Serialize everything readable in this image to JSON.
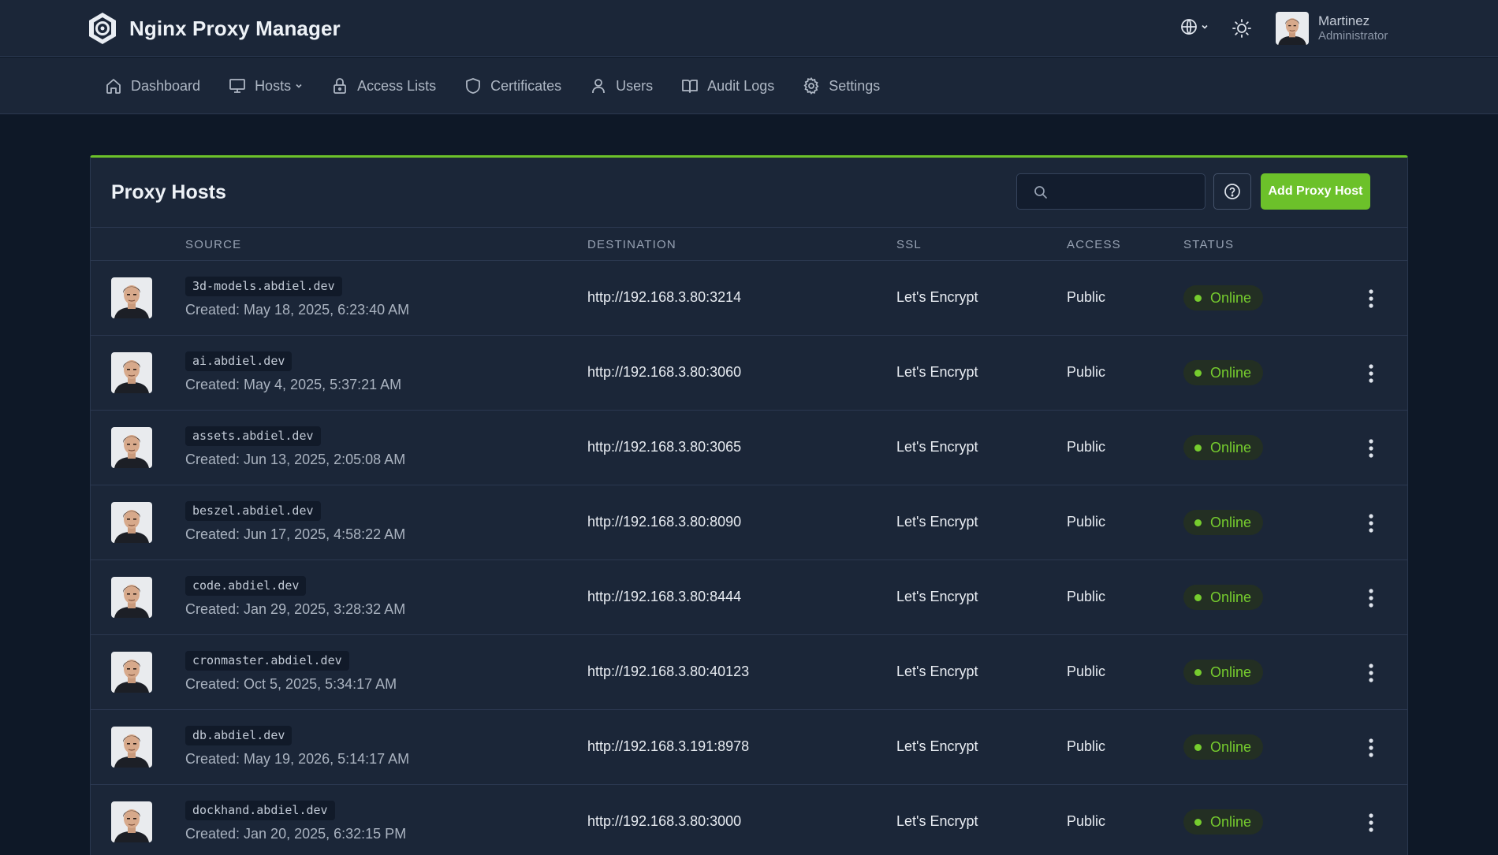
{
  "app": {
    "title": "Nginx Proxy Manager"
  },
  "user": {
    "name": "Martinez",
    "role": "Administrator"
  },
  "nav": [
    {
      "id": "dashboard",
      "label": "Dashboard",
      "icon": "home-icon"
    },
    {
      "id": "hosts",
      "label": "Hosts",
      "icon": "monitor-icon",
      "dropdown": true
    },
    {
      "id": "access-lists",
      "label": "Access Lists",
      "icon": "lock-icon"
    },
    {
      "id": "certificates",
      "label": "Certificates",
      "icon": "shield-icon"
    },
    {
      "id": "users",
      "label": "Users",
      "icon": "user-icon"
    },
    {
      "id": "audit-logs",
      "label": "Audit Logs",
      "icon": "book-icon"
    },
    {
      "id": "settings",
      "label": "Settings",
      "icon": "gear-icon"
    }
  ],
  "card": {
    "title": "Proxy Hosts",
    "search_value": "",
    "add_label": "Add Proxy Host"
  },
  "columns": {
    "source": "SOURCE",
    "destination": "DESTINATION",
    "ssl": "SSL",
    "access": "ACCESS",
    "status": "STATUS"
  },
  "colors": {
    "accent": "#6cc12a",
    "online": "#76cc2e",
    "background": "#0e1827",
    "surface": "#1b2638"
  },
  "hosts": [
    {
      "domain": "3d-models.abdiel.dev",
      "created": "Created: May 18, 2025, 6:23:40 AM",
      "destination": "http://192.168.3.80:3214",
      "ssl": "Let's Encrypt",
      "access": "Public",
      "status": "Online"
    },
    {
      "domain": "ai.abdiel.dev",
      "created": "Created: May 4, 2025, 5:37:21 AM",
      "destination": "http://192.168.3.80:3060",
      "ssl": "Let's Encrypt",
      "access": "Public",
      "status": "Online"
    },
    {
      "domain": "assets.abdiel.dev",
      "created": "Created: Jun 13, 2025, 2:05:08 AM",
      "destination": "http://192.168.3.80:3065",
      "ssl": "Let's Encrypt",
      "access": "Public",
      "status": "Online"
    },
    {
      "domain": "beszel.abdiel.dev",
      "created": "Created: Jun 17, 2025, 4:58:22 AM",
      "destination": "http://192.168.3.80:8090",
      "ssl": "Let's Encrypt",
      "access": "Public",
      "status": "Online"
    },
    {
      "domain": "code.abdiel.dev",
      "created": "Created: Jan 29, 2025, 3:28:32 AM",
      "destination": "http://192.168.3.80:8444",
      "ssl": "Let's Encrypt",
      "access": "Public",
      "status": "Online"
    },
    {
      "domain": "cronmaster.abdiel.dev",
      "created": "Created: Oct 5, 2025, 5:34:17 AM",
      "destination": "http://192.168.3.80:40123",
      "ssl": "Let's Encrypt",
      "access": "Public",
      "status": "Online"
    },
    {
      "domain": "db.abdiel.dev",
      "created": "Created: May 19, 2026, 5:14:17 AM",
      "destination": "http://192.168.3.191:8978",
      "ssl": "Let's Encrypt",
      "access": "Public",
      "status": "Online"
    },
    {
      "domain": "dockhand.abdiel.dev",
      "created": "Created: Jan 20, 2025, 6:32:15 PM",
      "destination": "http://192.168.3.80:3000",
      "ssl": "Let's Encrypt",
      "access": "Public",
      "status": "Online"
    }
  ]
}
